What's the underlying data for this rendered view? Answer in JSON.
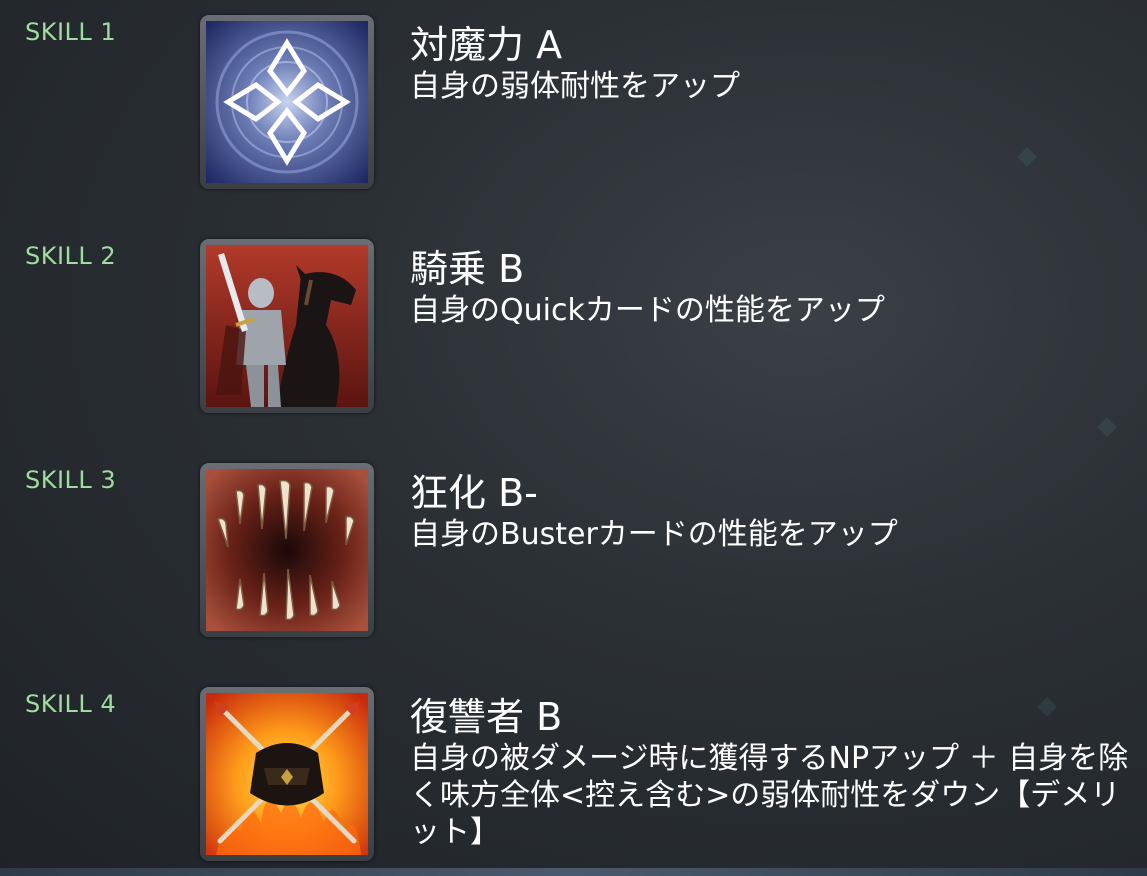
{
  "skills": [
    {
      "label": "SKILL 1",
      "name": "対魔力 A",
      "description": "自身の弱体耐性をアップ",
      "icon": "magic-resistance-icon"
    },
    {
      "label": "SKILL 2",
      "name": "騎乗 B",
      "description": "自身のQuickカードの性能をアップ",
      "icon": "riding-icon"
    },
    {
      "label": "SKILL 3",
      "name": "狂化 B-",
      "description": "自身のBusterカードの性能をアップ",
      "icon": "mad-enhancement-icon"
    },
    {
      "label": "SKILL 4",
      "name": "復讐者 B",
      "description": "自身の被ダメージ時に獲得するNPアップ ＋ 自身を除く味方全体<控え含む>の弱体耐性をダウン【デメリット】",
      "icon": "avenger-icon"
    }
  ],
  "colors": {
    "skill_label": "#9fdca0",
    "text": "#ffffff",
    "background": "#2b3035"
  }
}
